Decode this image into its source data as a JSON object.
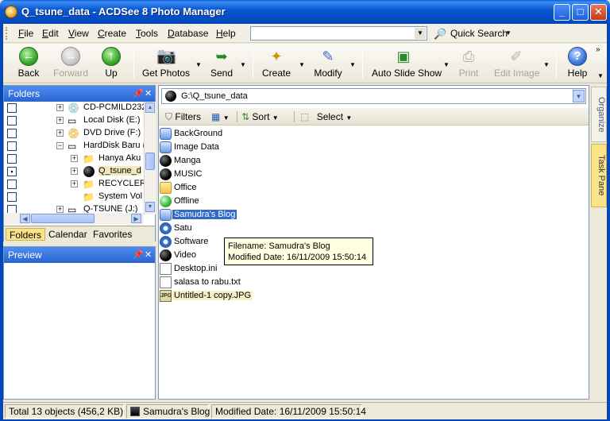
{
  "window": {
    "title": "Q_tsune_data - ACDSee 8 Photo Manager"
  },
  "menu": {
    "items": [
      "File",
      "Edit",
      "View",
      "Create",
      "Tools",
      "Database",
      "Help"
    ],
    "quick_search": "Quick Search"
  },
  "toolbar": {
    "back": "Back",
    "forward": "Forward",
    "up": "Up",
    "get_photos": "Get Photos",
    "send": "Send",
    "create": "Create",
    "modify": "Modify",
    "auto_slide_show": "Auto Slide Show",
    "print": "Print",
    "edit_image": "Edit Image",
    "help": "Help"
  },
  "folders_panel": {
    "title": "Folders",
    "tree": [
      {
        "label": "CD-PCMILD232",
        "icon": "cd-drive-icon"
      },
      {
        "label": "Local Disk (E:)",
        "icon": "disk-icon"
      },
      {
        "label": "DVD Drive (F:)",
        "icon": "dvd-drive-icon"
      },
      {
        "label": "HardDisk Baru (",
        "icon": "disk-icon"
      },
      {
        "label": "Hanya Aku",
        "icon": "folder-icon"
      },
      {
        "label": "Q_tsune_d",
        "icon": "ball-icon"
      },
      {
        "label": "RECYCLER",
        "icon": "folder-icon"
      },
      {
        "label": "System Vol",
        "icon": "folder-icon"
      },
      {
        "label": "Q-TSUNE (J:)",
        "icon": "disk-icon"
      }
    ],
    "tabs": [
      "Folders",
      "Calendar",
      "Favorites"
    ]
  },
  "preview_panel": {
    "title": "Preview"
  },
  "file_list": {
    "path": "G:\\Q_tsune_data",
    "toolbar": {
      "filters": "Filters",
      "sort": "Sort",
      "select": "Select"
    },
    "items": [
      {
        "name": "BackGround",
        "icon": "image-folder-icon"
      },
      {
        "name": "Image Data",
        "icon": "image-folder-icon"
      },
      {
        "name": "Manga",
        "icon": "ball-icon"
      },
      {
        "name": "MUSIC",
        "icon": "ball-icon"
      },
      {
        "name": "Office",
        "icon": "office-folder-icon"
      },
      {
        "name": "Offline",
        "icon": "green-globe-icon"
      },
      {
        "name": "Samudra's Blog",
        "icon": "blue-folder-icon"
      },
      {
        "name": "Satu",
        "icon": "gear-folder-icon"
      },
      {
        "name": "Software",
        "icon": "gear-icon"
      },
      {
        "name": "Video",
        "icon": "video-icon"
      },
      {
        "name": "Desktop.ini",
        "icon": "ini-file-icon"
      },
      {
        "name": "salasa to rabu.txt",
        "icon": "text-file-icon"
      },
      {
        "name": "Untitled-1 copy.JPG",
        "icon": "jpg-file-icon"
      }
    ],
    "tooltip": {
      "line1": "Filename: Samudra's Blog",
      "line2": "Modified Date: 16/11/2009 15:50:14"
    }
  },
  "side_tabs": {
    "organize": "Organize",
    "task_pane": "Task Pane"
  },
  "status": {
    "total": "Total 13 objects  (456,2 KB)",
    "selected": "Samudra's Blog",
    "modified": "Modified Date: 16/11/2009 15:50:14"
  }
}
